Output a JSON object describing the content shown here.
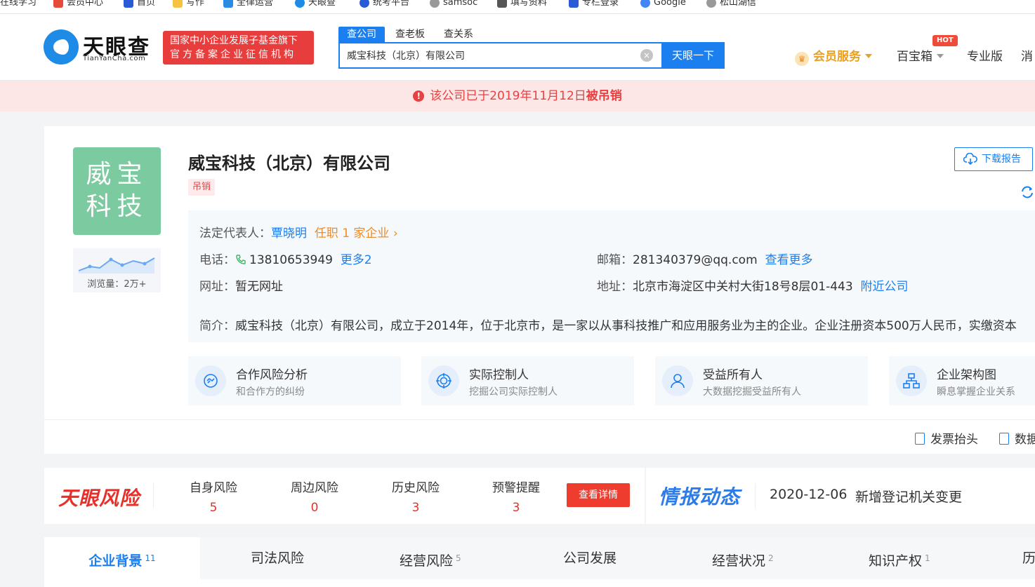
{
  "bookmarks": [
    {
      "label": "在线学习",
      "color": "#d8d8d8"
    },
    {
      "label": "会员中心",
      "color": "#e64a3b"
    },
    {
      "label": "首页",
      "color": "#2a5bd7"
    },
    {
      "label": "写作",
      "color": "#f5c242"
    },
    {
      "label": "全律运营",
      "color": "#2a8be0"
    },
    {
      "label": "天眼查",
      "color": "#1e8be6"
    },
    {
      "label": "统考平台",
      "color": "#2a5bd7"
    },
    {
      "label": "samsoc",
      "color": "#999999"
    },
    {
      "label": "填写资料",
      "color": "#555555"
    },
    {
      "label": "专栏登录",
      "color": "#2a5bd7"
    },
    {
      "label": "Google",
      "color": "#4285f4"
    },
    {
      "label": "松山湖信",
      "color": "#999999"
    }
  ],
  "header": {
    "logo_cn": "天眼查",
    "logo_en": "TianYanCha.com",
    "badge_line1": "国家中小企业发展子基金旗下",
    "badge_line2": "官方备案企业征信机构",
    "search_tabs": [
      "查公司",
      "查老板",
      "查关系"
    ],
    "search_value": "威宝科技（北京）有限公司",
    "search_button": "天眼一下",
    "clear_icon": "×",
    "nav": {
      "vip": "会员服务",
      "treasure": "百宝箱",
      "hot": "HOT",
      "pro": "专业版",
      "more": "消"
    }
  },
  "alert": {
    "icon": "!",
    "prefix": "该公司已于2019年11月12日",
    "bold": "被吊销"
  },
  "company": {
    "logo_line1": "威宝",
    "logo_line2": "科技",
    "views": "浏览量：2万+",
    "name": "威宝科技（北京）有限公司",
    "status": "吊销",
    "download": "下载报告",
    "legal_rep_label": "法定代表人：",
    "legal_rep": "覃晓明",
    "legal_rep_extra": "任职 1 家企业",
    "phone_label": "电话：",
    "phone": "13810653949",
    "phone_more": "更多2",
    "email_label": "邮箱：",
    "email": "281340379@qq.com",
    "email_more": "查看更多",
    "website_label": "网址：",
    "website": "暂无网址",
    "address_label": "地址：",
    "address": "北京市海淀区中关村大街18号8层01-443",
    "address_more": "附近公司",
    "intro_label": "简介：",
    "intro": "威宝科技（北京）有限公司，成立于2014年，位于北京市，是一家以从事科技推广和应用服务业为主的企业。企业注册资本500万人民币，实缴资本"
  },
  "features": [
    {
      "title": "合作风险分析",
      "sub": "和合作方的纠纷",
      "icon": "handshake-icon"
    },
    {
      "title": "实际控制人",
      "sub": "挖掘公司实际控制人",
      "icon": "target-icon"
    },
    {
      "title": "受益所有人",
      "sub": "大数据挖掘受益所有人",
      "icon": "person-icon"
    },
    {
      "title": "企业架构图",
      "sub": "瞬息掌握企业关系",
      "icon": "org-chart-icon"
    }
  ],
  "bottom_links": [
    "发票抬头",
    "数据"
  ],
  "risk": {
    "logo": "天眼风险",
    "items": [
      {
        "label": "自身风险",
        "value": "5"
      },
      {
        "label": "周边风险",
        "value": "0"
      },
      {
        "label": "历史风险",
        "value": "3"
      },
      {
        "label": "预警提醒",
        "value": "3"
      }
    ],
    "detail_button": "查看详情"
  },
  "intel": {
    "logo": "情报动态",
    "date": "2020-12-06",
    "text": "新增登记机关变更"
  },
  "tabs": [
    {
      "label": "企业背景",
      "count": "11"
    },
    {
      "label": "司法风险",
      "count": ""
    },
    {
      "label": "经营风险",
      "count": "5"
    },
    {
      "label": "公司发展",
      "count": ""
    },
    {
      "label": "经营状况",
      "count": "2"
    },
    {
      "label": "知识产权",
      "count": "1"
    },
    {
      "label": "历",
      "count": ""
    }
  ],
  "colors": {
    "brand": "#1b7ff0",
    "danger": "#e84141",
    "vip": "#e9a023",
    "logo_green": "#7ccaa0"
  }
}
